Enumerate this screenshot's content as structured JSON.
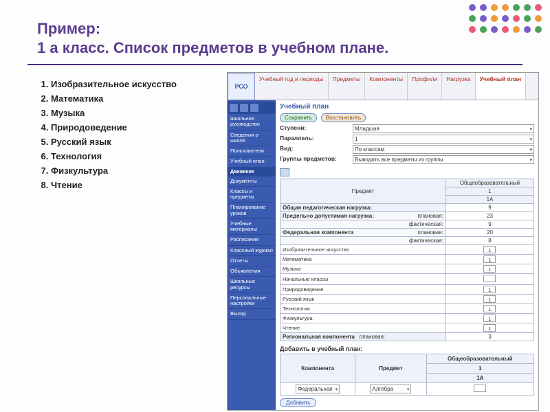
{
  "slide": {
    "title_line1": "Пример:",
    "title_line2": "1 а класс. Список предметов в учебном плане."
  },
  "subjects_list": [
    "Изобразительное искусство",
    "Математика",
    "Музыка",
    "Природоведение",
    "Русский язык",
    "Технология",
    "Физкультура",
    "Чтение"
  ],
  "app": {
    "logo": "РСО",
    "tabs": [
      "Учебный год и периоды",
      "Предметы",
      "Компоненты",
      "Профили",
      "Нагрузка",
      "Учебный план"
    ],
    "active_tab": 5,
    "sidebar": {
      "items_top": [
        "Школьное руководство",
        "Сведения о школе",
        "Пользователи",
        "Учебный план"
      ],
      "section": "Движение",
      "items_bottom": [
        "Документы",
        "Классы и предметы",
        "Планирование уроков",
        "Учебные материалы",
        "Расписание",
        "Классный журнал",
        "Отчеты",
        "Объявления",
        "Школьные ресурсы",
        "Персональные настройки",
        "Выход"
      ]
    },
    "page": {
      "title": "Учебный план",
      "save_btn": "Сохранить",
      "restore_btn": "Восстановить",
      "fields": {
        "level_label": "Ступени:",
        "level_value": "Младшая",
        "parallel_label": "Параллель:",
        "parallel_value": "1",
        "view_label": "Вид:",
        "view_value": "По классам",
        "groups_label": "Группы предметов:",
        "groups_value": "Выводить все предметы из группы"
      },
      "plan_table": {
        "col_subject": "Предмет",
        "col_edutype": "Общеобразовательный",
        "col_grade": "1",
        "col_class": "1А",
        "rows": [
          {
            "head": "Общая педагогическая нагрузка:",
            "val": "9"
          },
          {
            "head": "Предельно допустимая нагрузка:",
            "sub": "плановая:",
            "val": "23"
          },
          {
            "head": "",
            "sub": "фактическая:",
            "val": "9"
          },
          {
            "head": "Федеральная компонента",
            "sub": "плановая:",
            "val": "20"
          },
          {
            "head": "",
            "sub": "фактическая:",
            "val": "8"
          }
        ],
        "subjects": [
          {
            "name": "Изобразительное искусство",
            "val": "1"
          },
          {
            "name": "Математика",
            "val": "1"
          },
          {
            "name": "Музыка",
            "val": "1"
          },
          {
            "name": "Начальные классы",
            "val": ""
          },
          {
            "name": "Природоведение",
            "val": "1"
          },
          {
            "name": "Русский язык",
            "val": "1"
          },
          {
            "name": "Технология",
            "val": "1"
          },
          {
            "name": "Физкультура",
            "val": "1"
          },
          {
            "name": "Чтение",
            "val": "1"
          }
        ],
        "regional_row": {
          "head": "Региональная компонента",
          "sub": "плановая:",
          "val": "3"
        }
      },
      "add_section": {
        "title": "Добавить в учебный план:",
        "col_component": "Компонента",
        "col_subject": "Предмет",
        "col_edutype": "Общеобразовательный",
        "col_grade": "1",
        "col_class": "1А",
        "component_value": "Федеральная",
        "subject_value": "Алгебра",
        "hours_value": "",
        "add_btn": "Добавить"
      }
    }
  },
  "deco_colors": [
    "#7a5cc9",
    "#7a5cc9",
    "#f29b3a",
    "#f29b3a",
    "#4aa35a",
    "#4aa35a",
    "#e85a7a",
    "#4aa35a",
    "#7a5cc9",
    "#f29b3a",
    "#7a5cc9",
    "#e85a7a",
    "#4aa35a",
    "#f29b3a",
    "#e85a7a",
    "#4aa35a",
    "#7a5cc9",
    "#e85a7a",
    "#f29b3a",
    "#7a5cc9",
    "#4aa35a"
  ]
}
